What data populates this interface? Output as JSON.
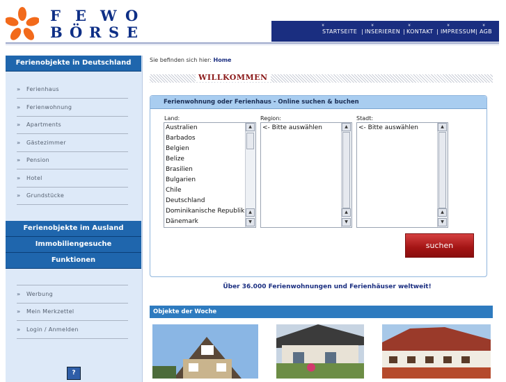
{
  "logo": {
    "line1": [
      "F",
      "E",
      "W",
      "O"
    ],
    "line2": [
      "B",
      "Ö",
      "R",
      "S",
      "E"
    ],
    "colors": {
      "star": "#f26a1b",
      "text": "#0e2f86"
    }
  },
  "topnav": {
    "items": [
      "STARTSEITE",
      "INSERIEREN",
      "KONTAKT",
      "IMPRESSUM",
      "AGB"
    ],
    "separator": "|",
    "arrow": "»",
    "color": "#1a2e80"
  },
  "sidebar": {
    "header_de": "Ferienobjekte in Deutschland",
    "items_de": [
      "Ferienhaus",
      "Ferienwohnung",
      "Apartments",
      "Gästezimmer",
      "Pension",
      "Hotel",
      "Grundstücke"
    ],
    "header_abroad": "Ferienobjekte im Ausland",
    "header_realestate": "Immobiliengesuche",
    "header_functions": "Funktionen",
    "items_functions": [
      "Werbung",
      "Mein Merkzettel",
      "Login / Anmelden"
    ],
    "item_arrow": "»",
    "help_icon": "?"
  },
  "breadcrumb": {
    "prefix": "Sie befinden sich hier:",
    "current": "Home"
  },
  "welcome": "WILLKOMMEN",
  "search": {
    "title": "Ferienwohnung oder Ferienhaus - Online suchen & buchen",
    "land_label": "Land:",
    "region_label": "Region:",
    "stadt_label": "Stadt:",
    "land_options": [
      "Australien",
      "Barbados",
      "Belgien",
      "Belize",
      "Brasilien",
      "Bulgarien",
      "Chile",
      "Deutschland",
      "Dominikanische Republik",
      "Dänemark"
    ],
    "region_options": [
      "<- Bitte auswählen"
    ],
    "stadt_options": [
      "<- Bitte auswählen"
    ],
    "button": "suchen"
  },
  "claim": "Über 36.000 Ferienwohnungen und Ferienhäuser weltweit!",
  "week": {
    "title": "Objekte der Woche"
  }
}
